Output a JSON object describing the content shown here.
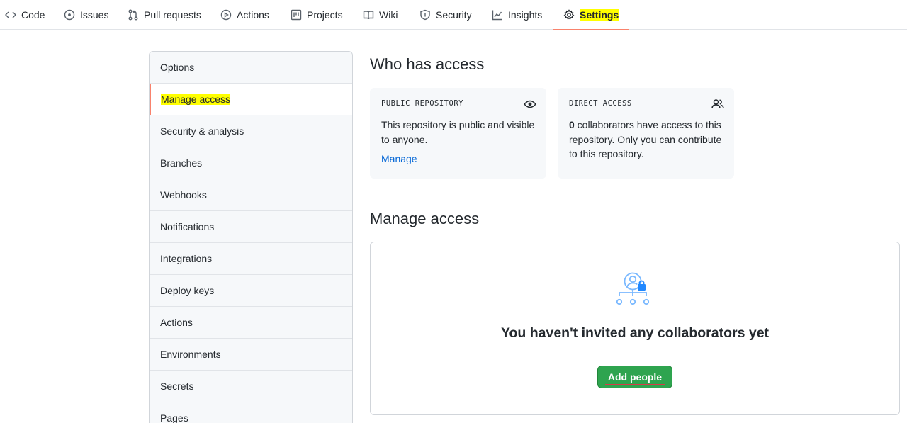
{
  "topnav": {
    "tabs": [
      {
        "label": "Code",
        "icon": "code-icon"
      },
      {
        "label": "Issues",
        "icon": "issue-opened-icon"
      },
      {
        "label": "Pull requests",
        "icon": "git-pull-request-icon"
      },
      {
        "label": "Actions",
        "icon": "play-icon"
      },
      {
        "label": "Projects",
        "icon": "project-icon"
      },
      {
        "label": "Wiki",
        "icon": "book-icon"
      },
      {
        "label": "Security",
        "icon": "shield-icon"
      },
      {
        "label": "Insights",
        "icon": "graph-icon"
      },
      {
        "label": "Settings",
        "icon": "gear-icon",
        "active": true
      }
    ]
  },
  "sidebar": {
    "items": [
      {
        "label": "Options"
      },
      {
        "label": "Manage access",
        "selected": true
      },
      {
        "label": "Security & analysis"
      },
      {
        "label": "Branches"
      },
      {
        "label": "Webhooks"
      },
      {
        "label": "Notifications"
      },
      {
        "label": "Integrations"
      },
      {
        "label": "Deploy keys"
      },
      {
        "label": "Actions"
      },
      {
        "label": "Environments"
      },
      {
        "label": "Secrets"
      },
      {
        "label": "Pages"
      }
    ]
  },
  "who_has_access": {
    "title": "Who has access",
    "public_card": {
      "label": "PUBLIC REPOSITORY",
      "icon": "eye-icon",
      "text": "This repository is public and visible to anyone.",
      "link": "Manage"
    },
    "direct_card": {
      "label": "DIRECT ACCESS",
      "icon": "people-icon",
      "count": "0",
      "text": " collaborators have access to this repository. Only you can contribute to this repository."
    }
  },
  "manage_access": {
    "title": "Manage access",
    "empty_icon": "collaborators-lock-icon",
    "empty_title": "You haven't invited any collaborators yet",
    "add_button": "Add people"
  },
  "colors": {
    "accent_underline": "#f9826c",
    "highlight": "#ffff00",
    "button_green": "#2ea44f",
    "link_blue": "#0366d6",
    "illustration_blue": "#79b8ff"
  }
}
